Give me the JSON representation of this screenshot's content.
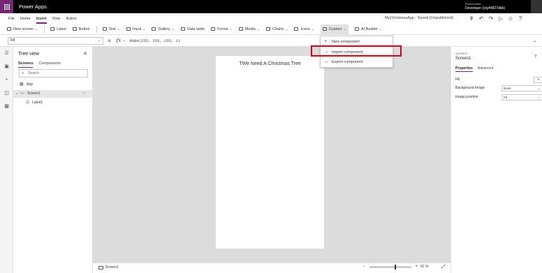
{
  "app": {
    "title": "Power Apps"
  },
  "environment": {
    "label": "Environment",
    "name": "Developer (org44827dbb)"
  },
  "menu": {
    "items": [
      {
        "label": "File"
      },
      {
        "label": "Home"
      },
      {
        "label": "Insert"
      },
      {
        "label": "View"
      },
      {
        "label": "Action"
      }
    ],
    "active": "Insert",
    "saved_status": "MyChristmasApp - Saved (Unpublished)"
  },
  "ribbon": {
    "new_screen": "New screen",
    "label": "Label",
    "button": "Button",
    "text": "Text",
    "input": "Input",
    "gallery": "Gallery",
    "data_table": "Data table",
    "forms": "Forms",
    "media": "Media",
    "charts": "Charts",
    "icons": "Icons",
    "custom": "Custom",
    "ai_builder": "AI Builder"
  },
  "formula_bar": {
    "property": "Fill",
    "fx": "fx",
    "formula": "RGBA(255, 255, 255, 1)"
  },
  "tree_view": {
    "title": "Tree view",
    "tabs": [
      {
        "label": "Screens"
      },
      {
        "label": "Components"
      }
    ],
    "search_placeholder": "Search",
    "items": {
      "app": "App",
      "screen": "Screen1",
      "label": "Label1"
    }
  },
  "canvas": {
    "label_text": "TWe Need A Christmas Tree"
  },
  "custom_menu": {
    "items": [
      {
        "label": "New component",
        "icon": "plus-icon"
      },
      {
        "label": "Import component",
        "icon": "import-icon"
      },
      {
        "label": "Export component",
        "icon": "export-icon"
      }
    ],
    "highlight_color": "#d0021b"
  },
  "properties": {
    "kind": "SCREEN",
    "name": "Screen1",
    "tabs": [
      {
        "label": "Properties"
      },
      {
        "label": "Advanced"
      }
    ],
    "fill_label": "Fill",
    "bg_image_label": "Background image",
    "bg_image_value": "None",
    "img_position_label": "Image position",
    "img_position_value": "Fit"
  },
  "status_bar": {
    "screen": "Screen1",
    "zoom": "62 %",
    "zoom_level": 0.62
  },
  "colors": {
    "brand": "#742774",
    "topbar": "#000000",
    "canvas_bg": "#dcdcdc"
  }
}
